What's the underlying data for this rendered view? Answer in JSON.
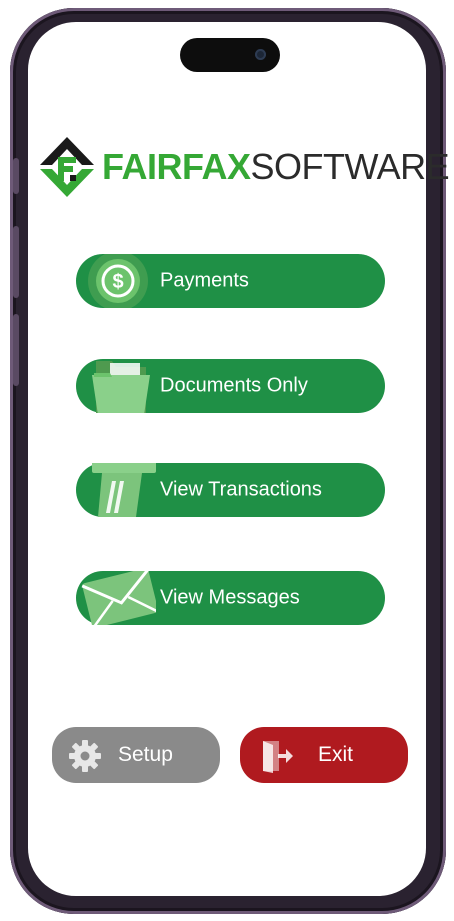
{
  "branding": {
    "name_bold": "FAIRFAX",
    "name_light": "SOFTWARE",
    "brand_green": "#35a835"
  },
  "menu": {
    "payments_label": "Payments",
    "documents_label": "Documents Only",
    "transactions_label": "View Transactions",
    "messages_label": "View Messages",
    "button_color": "#1f9046"
  },
  "footer": {
    "setup_label": "Setup",
    "exit_label": "Exit",
    "setup_color": "#8a8a8a",
    "exit_color": "#b01a1f"
  },
  "icons": {
    "logo": "fairfax-logo-icon",
    "payments": "dollar-coin-icon",
    "documents": "folder-icon",
    "transactions": "card-slot-icon",
    "messages": "envelope-icon",
    "setup": "gear-icon",
    "exit": "exit-door-icon"
  }
}
